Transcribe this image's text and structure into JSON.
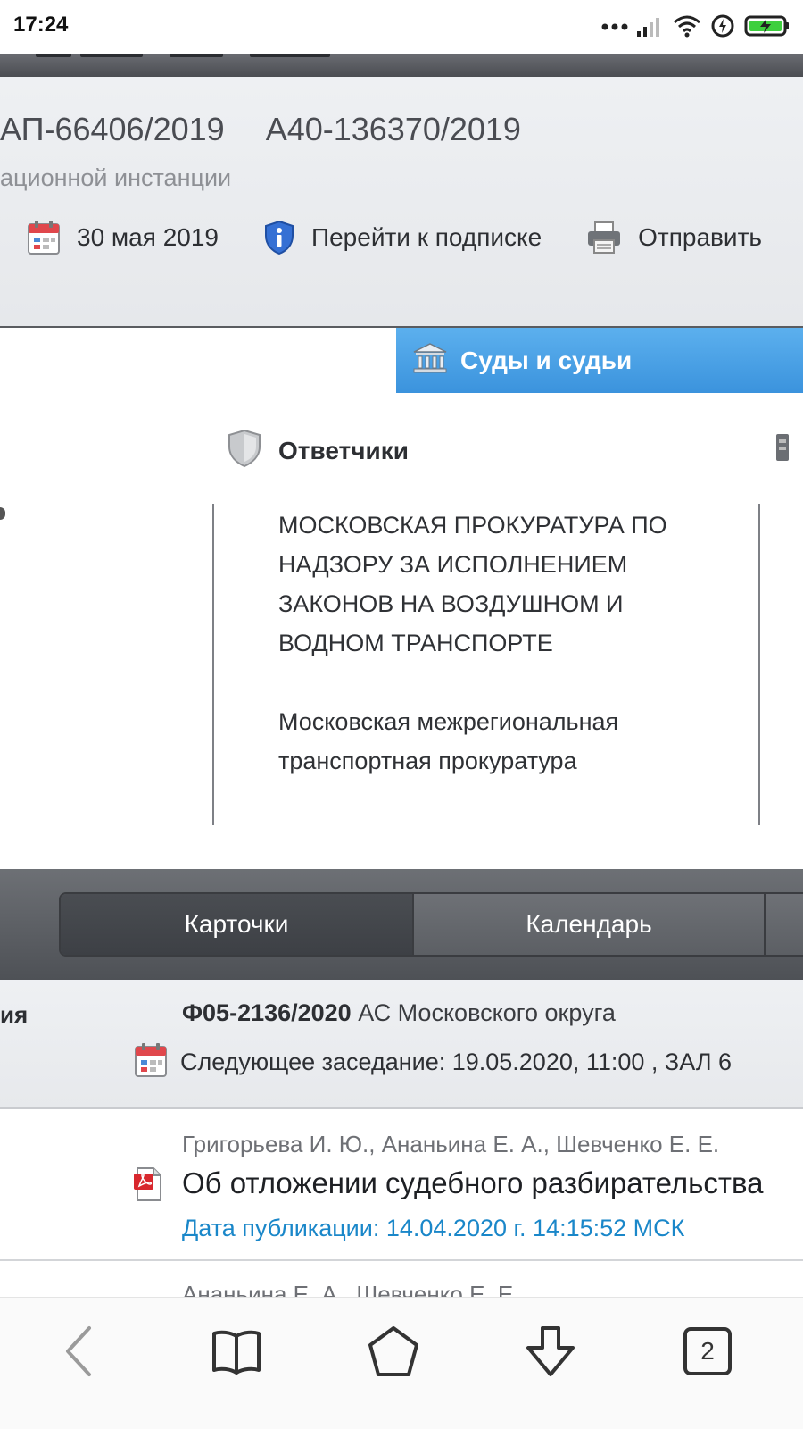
{
  "status_bar": {
    "time": "17:24",
    "icons": [
      "dots-icon",
      "signal-icon",
      "wifi-icon",
      "data-saver-icon",
      "battery-charging-icon"
    ]
  },
  "case_header": {
    "case_numbers": [
      "АП-66406/2019",
      "А40-136370/2019"
    ],
    "instance": "ационной инстанции",
    "actions": [
      {
        "icon": "calendar-icon",
        "label": "30 мая 2019"
      },
      {
        "icon": "info-shield-icon",
        "label": "Перейти к подписке"
      },
      {
        "icon": "printer-icon",
        "label": "Отправить"
      }
    ]
  },
  "courts_tab": {
    "label": "Суды и судьи",
    "icon": "courthouse-icon"
  },
  "defendants": {
    "heading": "Ответчики",
    "heading_icon": "shield-icon",
    "items": [
      [
        "МОСКОВСКАЯ ПРОКУРАТУРА ПО",
        "НАДЗОРУ ЗА ИСПОЛНЕНИЕМ",
        "ЗАКОНОВ НА ВОЗДУШНОМ И",
        "ВОДНОМ ТРАНСПОРТЕ"
      ],
      [
        "Московская межрегиональная",
        "транспортная прокуратура"
      ]
    ]
  },
  "tabs": {
    "items": [
      "Карточки",
      "Календарь"
    ],
    "active": "Карточки"
  },
  "session": {
    "left_label": "ия",
    "case_no": "Ф05-2136/2020",
    "court": "АС Московского округа",
    "next_meeting": "Следующее заседание: 19.05.2020, 11:00 , ЗАЛ 6"
  },
  "document": {
    "judges": "Григорьева И. Ю., Ананьина Е. А., Шевченко Е. Е.",
    "title": "Об отложении судебного разбирательства",
    "published": "Дата публикации: 14.04.2020 г. 14:15:52 МСК",
    "icon": "pdf-icon"
  },
  "next_document_partial": "Ананьина Е. А., Шевченко Е. Е.",
  "browser_bar": {
    "buttons": [
      "back-icon",
      "bookmarks-icon",
      "home-icon",
      "downloads-icon",
      "tabs-icon"
    ],
    "tabs_count": "2"
  },
  "colors": {
    "accent_blue": "#3b93dd",
    "link_blue": "#1a87c9",
    "dark_band": "#4e5156"
  }
}
